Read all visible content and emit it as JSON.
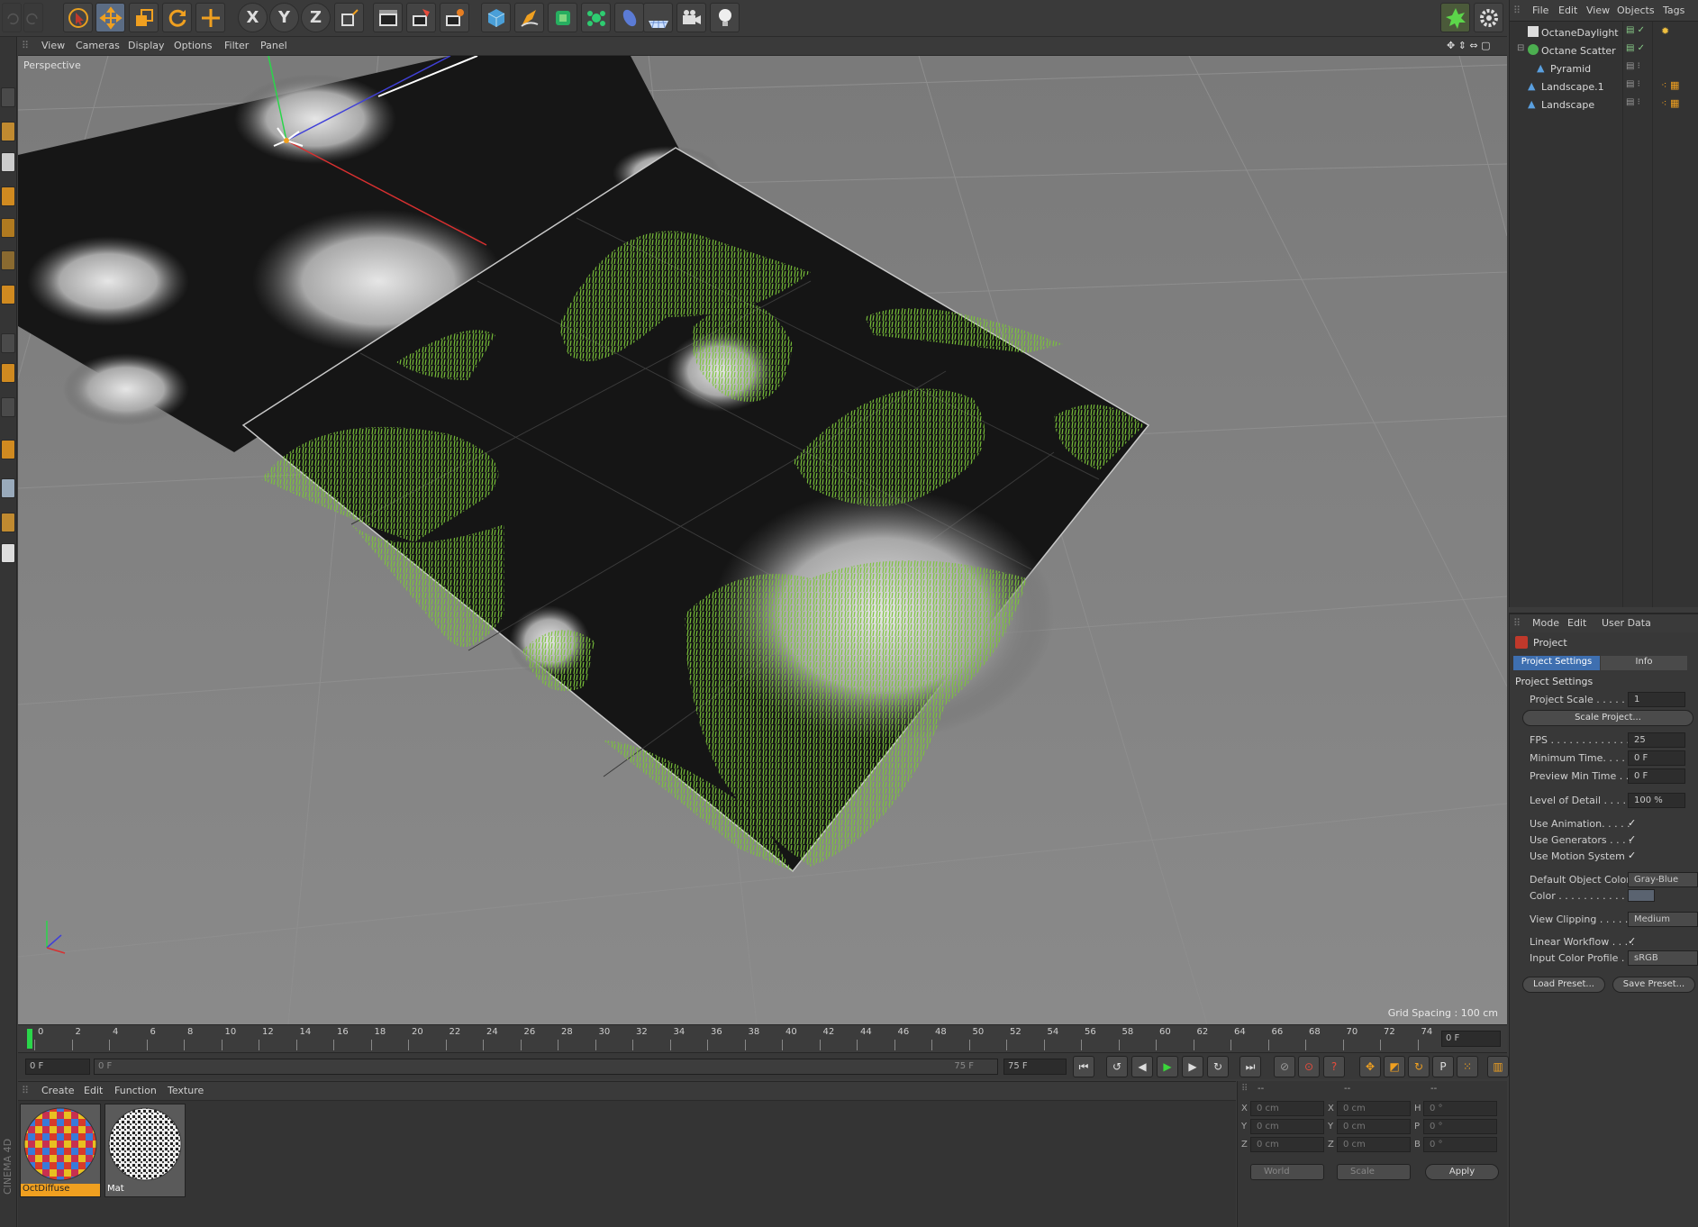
{
  "viewport_menu": [
    "View",
    "Cameras",
    "Display",
    "Options",
    "Filter",
    "Panel"
  ],
  "viewport": {
    "camera_label": "Perspective",
    "grid_spacing": "Grid Spacing : 100 cm"
  },
  "toolbar": {
    "axis_x": "X",
    "axis_y": "Y",
    "axis_z": "Z"
  },
  "timeline": {
    "ticks": [
      "0",
      "2",
      "4",
      "6",
      "8",
      "10",
      "12",
      "14",
      "16",
      "18",
      "20",
      "22",
      "24",
      "26",
      "28",
      "30",
      "32",
      "34",
      "36",
      "38",
      "40",
      "42",
      "44",
      "46",
      "48",
      "50",
      "52",
      "54",
      "56",
      "58",
      "60",
      "62",
      "64",
      "66",
      "68",
      "70",
      "72",
      "74"
    ],
    "current_frame": "0 F"
  },
  "playback": {
    "start": "0 F",
    "range_start": "0 F",
    "range_end": "75 F",
    "end": "75 F"
  },
  "material_menu": [
    "Create",
    "Edit",
    "Function",
    "Texture"
  ],
  "materials": [
    {
      "name": "OctDiffuse"
    },
    {
      "name": "Mat"
    }
  ],
  "coords": {
    "header": [
      "--",
      "--",
      "--"
    ],
    "rows": [
      {
        "a": "X",
        "av": "0 cm",
        "b": "X",
        "bv": "0 cm",
        "c": "H",
        "cv": "0 °"
      },
      {
        "a": "Y",
        "av": "0 cm",
        "b": "Y",
        "bv": "0 cm",
        "c": "P",
        "cv": "0 °"
      },
      {
        "a": "Z",
        "av": "0 cm",
        "b": "Z",
        "bv": "0 cm",
        "c": "B",
        "cv": "0 °"
      }
    ],
    "mode": "World",
    "scale": "Scale",
    "apply": "Apply"
  },
  "app_label": "CINEMA 4D",
  "object_menu": [
    "File",
    "Edit",
    "View",
    "Objects",
    "Tags"
  ],
  "objects": [
    "OctaneDaylight",
    "Octane Scatter",
    "Pyramid",
    "Landscape.1",
    "Landscape"
  ],
  "attr_menu": [
    "Mode",
    "Edit",
    "User Data"
  ],
  "attr": {
    "title": "Project",
    "tabs": [
      "Project Settings",
      "Info"
    ],
    "section": "Project Settings",
    "project_scale_label": "Project Scale . . . . . .",
    "project_scale": "1",
    "scale_project": "Scale Project...",
    "fps_label": "FPS . . . . . . . . . . . . . .",
    "fps": "25",
    "min_time_label": "Minimum Time. . . . .",
    "min_time": "0 F",
    "preview_min_label": "Preview Min Time . .",
    "preview_min": "0 F",
    "lod_label": "Level of Detail . . . . . .",
    "lod": "100 %",
    "use_anim": "Use Animation. . . . .",
    "use_gen": "Use Generators . . . .",
    "use_motion": "Use Motion System",
    "default_color_label": "Default Object Color",
    "default_color": "Gray-Blue",
    "color_label": "Color . . . . . . . . . . .",
    "view_clip_label": "View Clipping . . . . . .",
    "view_clip": "Medium",
    "linear_label": "Linear Workflow . . . .",
    "input_profile_label": "Input Color Profile . .",
    "input_profile": "sRGB",
    "load_preset": "Load Preset...",
    "save_preset": "Save Preset...",
    "check": "✓"
  }
}
